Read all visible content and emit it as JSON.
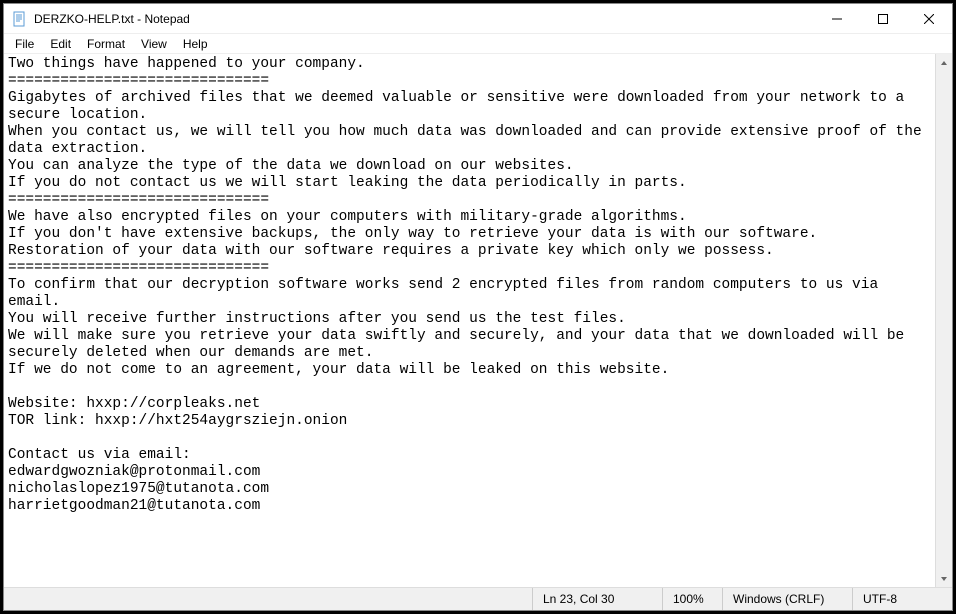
{
  "window": {
    "title": "DERZKO-HELP.txt - Notepad"
  },
  "menu": {
    "file": "File",
    "edit": "Edit",
    "format": "Format",
    "view": "View",
    "help": "Help"
  },
  "content": "Two things have happened to your company.\n==============================\nGigabytes of archived files that we deemed valuable or sensitive were downloaded from your network to a secure location.\nWhen you contact us, we will tell you how much data was downloaded and can provide extensive proof of the data extraction.\nYou can analyze the type of the data we download on our websites.\nIf you do not contact us we will start leaking the data periodically in parts.\n==============================\nWe have also encrypted files on your computers with military-grade algorithms.\nIf you don't have extensive backups, the only way to retrieve your data is with our software.\nRestoration of your data with our software requires a private key which only we possess.\n==============================\nTo confirm that our decryption software works send 2 encrypted files from random computers to us via email.\nYou will receive further instructions after you send us the test files.\nWe will make sure you retrieve your data swiftly and securely, and your data that we downloaded will be securely deleted when our demands are met.\nIf we do not come to an agreement, your data will be leaked on this website.\n\nWebsite: hxxp://corpleaks.net\nTOR link: hxxp://hxt254aygrsziejn.onion\n\nContact us via email:\nedwardgwozniak@protonmail.com\nnicholaslopez1975@tutanota.com\nharrietgoodman21@tutanota.com",
  "status": {
    "position": "Ln 23, Col 30",
    "zoom": "100%",
    "eol": "Windows (CRLF)",
    "encoding": "UTF-8"
  }
}
